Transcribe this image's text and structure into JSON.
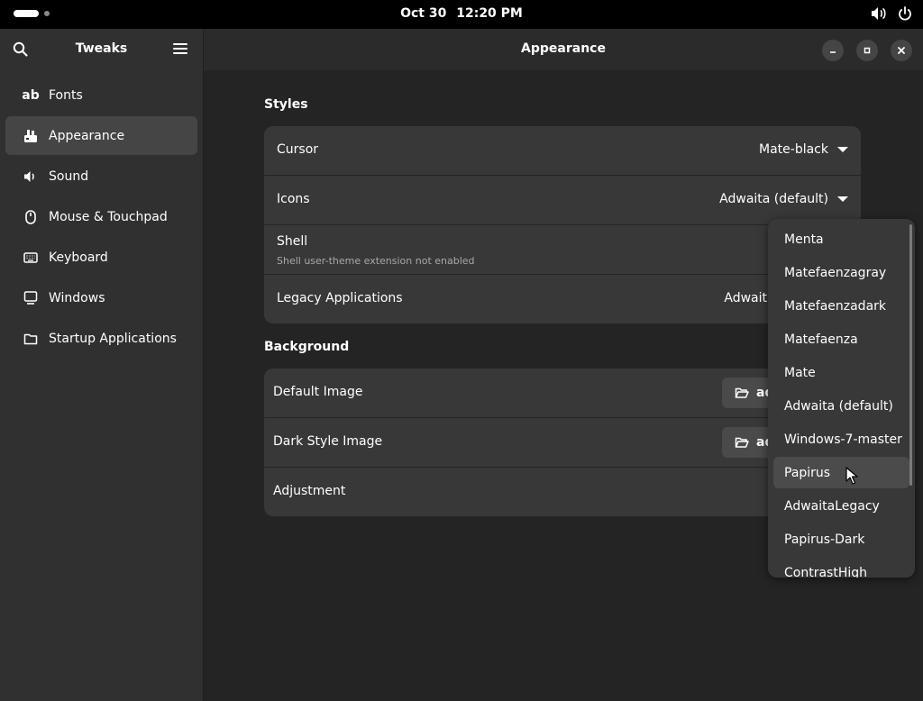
{
  "topbar": {
    "date": "Oct 30",
    "time": "12:20 PM"
  },
  "sidebar": {
    "title": "Tweaks",
    "items": [
      {
        "label": "Fonts",
        "icon": "ab",
        "active": false
      },
      {
        "label": "Appearance",
        "icon": "appearance-icon",
        "active": true
      },
      {
        "label": "Sound",
        "icon": "speaker-icon",
        "active": false
      },
      {
        "label": "Mouse & Touchpad",
        "icon": "mouse-icon",
        "active": false
      },
      {
        "label": "Keyboard",
        "icon": "keyboard-icon",
        "active": false
      },
      {
        "label": "Windows",
        "icon": "monitor-icon",
        "active": false
      },
      {
        "label": "Startup Applications",
        "icon": "folder-icon",
        "active": false
      }
    ]
  },
  "main": {
    "title": "Appearance",
    "styles": {
      "title": "Styles",
      "cursor": {
        "label": "Cursor",
        "value": "Mate-black"
      },
      "icons": {
        "label": "Icons",
        "value": "Adwaita (default)"
      },
      "shell": {
        "label": "Shell",
        "sublabel": "Shell user-theme extension not enabled"
      },
      "legacy": {
        "label": "Legacy Applications",
        "value": "Adwait"
      }
    },
    "background": {
      "title": "Background",
      "default_image": {
        "label": "Default Image",
        "button": "ad"
      },
      "dark_image": {
        "label": "Dark Style Image",
        "button": "ad"
      },
      "adjustment": {
        "label": "Adjustment"
      }
    }
  },
  "popover": {
    "items": [
      "Menta",
      "Matefaenzagray",
      "Matefaenzadark",
      "Matefaenza",
      "Mate",
      "Adwaita (default)",
      "Windows-7-master",
      "Papirus",
      "AdwaitaLegacy",
      "Papirus-Dark",
      "ContrastHigh"
    ],
    "hovered": "Papirus"
  },
  "colors": {
    "topbar": "#000000",
    "sidebar_bg": "#303030",
    "main_bg": "#242424",
    "card_bg": "#383838",
    "active_item": "#454545"
  }
}
